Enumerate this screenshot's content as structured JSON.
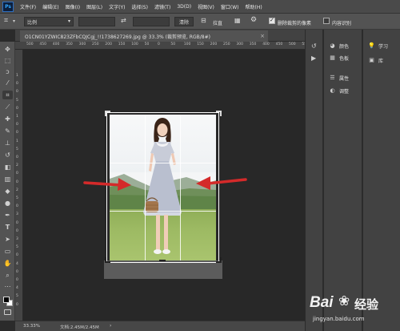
{
  "app": {
    "logo": "Ps"
  },
  "menu": [
    "文件(F)",
    "编辑(E)",
    "图像(I)",
    "图层(L)",
    "文字(Y)",
    "选择(S)",
    "滤镜(T)",
    "3D(D)",
    "视图(V)",
    "窗口(W)",
    "帮助(H)"
  ],
  "options": {
    "ratio": "比例",
    "clear": "清除",
    "straighten": "拉直",
    "delete_cropped": "删除裁剪的像素",
    "content_aware": "内容识别"
  },
  "document": {
    "tab_title": "O1CN01YZWIC823ZFbCQJCgj_!!1738627269.jpg @ 33.3% (裁剪预览, RGB/8#)",
    "close": "×"
  },
  "ruler": {
    "top": [
      "500",
      "450",
      "400",
      "350",
      "300",
      "250",
      "200",
      "150",
      "100",
      "50",
      "0",
      "50",
      "100",
      "150",
      "200",
      "250",
      "300",
      "350",
      "400",
      "450",
      "500",
      "550"
    ],
    "left": [
      "1",
      "0",
      "0",
      "5",
      "0",
      "1",
      "0",
      "0",
      "1",
      "5",
      "0",
      "2",
      "0",
      "0",
      "2",
      "5",
      "0",
      "3",
      "0",
      "0",
      "3",
      "5",
      "0",
      "4",
      "0",
      "0",
      "4",
      "5",
      "0"
    ]
  },
  "status": {
    "zoom": "33.33%",
    "doc": "文档:2.45M/2.45M"
  },
  "panels": {
    "color": "颜色",
    "swatches": "色板",
    "properties": "属性",
    "adjustments": "调整",
    "learn": "学习",
    "libraries": "库"
  },
  "watermark": {
    "brand": "Bai",
    "brand2": "经验",
    "url": "jingyan.baidu.com"
  },
  "colors": {
    "arrow": "#d42a2a",
    "accent": "#31a8ff"
  }
}
